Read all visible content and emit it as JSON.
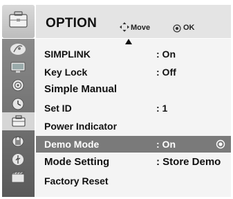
{
  "header": {
    "title": "OPTION",
    "move_hint": "Move",
    "ok_hint": "OK",
    "icon": "option-briefcase-icon"
  },
  "sidebar": {
    "items": [
      {
        "icon": "satellite-dish-icon"
      },
      {
        "icon": "monitor-icon"
      },
      {
        "icon": "speaker-icon"
      },
      {
        "icon": "clock-icon"
      },
      {
        "icon": "briefcase-icon",
        "active": true
      },
      {
        "icon": "lock-icon"
      },
      {
        "icon": "usb-icon"
      },
      {
        "icon": "film-icon"
      }
    ]
  },
  "menu": {
    "items": [
      {
        "label": "SIMPLINK",
        "value": ": On"
      },
      {
        "label": "Key Lock",
        "value": ": Off"
      },
      {
        "label": "Simple Manual",
        "value": ""
      },
      {
        "label": "Set ID",
        "value": ": 1"
      },
      {
        "label": "Power Indicator",
        "value": ""
      },
      {
        "label": "Demo Mode",
        "value": ": On",
        "selected": true
      },
      {
        "label": "Mode Setting",
        "value": ": Store Demo"
      },
      {
        "label": "Factory Reset",
        "value": ""
      }
    ]
  },
  "colors": {
    "selected_row": "#7a7a7a",
    "header_bar": "#e4e4e4",
    "sidebar": "#6e6e6e",
    "active_sidebar": "#d6d6d6"
  }
}
